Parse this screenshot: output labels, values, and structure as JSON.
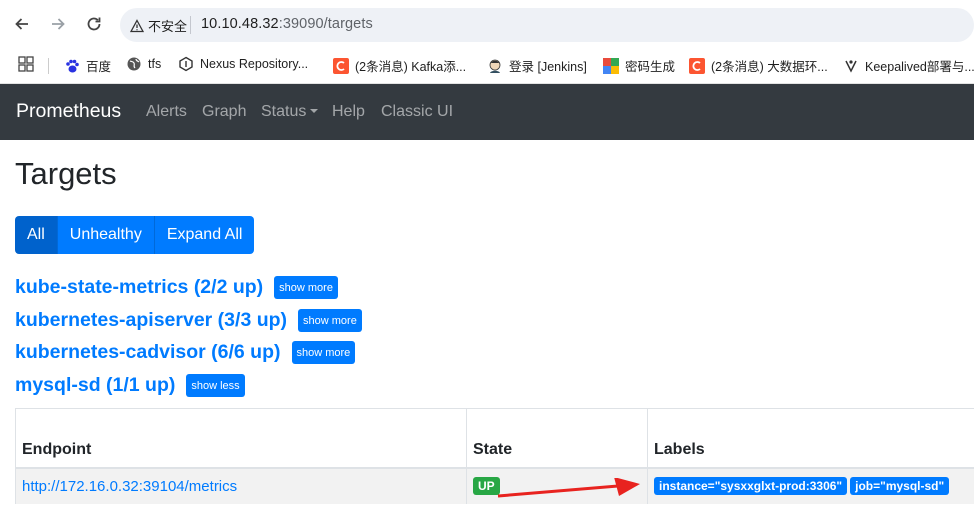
{
  "browser": {
    "security_label": "不安全",
    "url_host": "10.10.48.32",
    "url_path": ":39090/targets",
    "bookmarks": [
      {
        "label": "百度",
        "icon": "paw-icon"
      },
      {
        "label": "tfs",
        "icon": "globe-icon"
      },
      {
        "label": "Nexus Repository...",
        "icon": "nexus-icon"
      },
      {
        "label": "(2条消息) Kafka添...",
        "icon": "csdn-icon"
      },
      {
        "label": "登录 [Jenkins]",
        "icon": "jenkins-icon"
      },
      {
        "label": "密码生成",
        "icon": "puzzle-icon"
      },
      {
        "label": "(2条消息) 大数据环...",
        "icon": "csdn-icon"
      },
      {
        "label": "Keepalived部署与...",
        "icon": "keepalived-icon"
      }
    ]
  },
  "navbar": {
    "brand": "Prometheus",
    "links": [
      "Alerts",
      "Graph",
      "Status",
      "Help",
      "Classic UI"
    ]
  },
  "page": {
    "title": "Targets",
    "filters": [
      "All",
      "Unhealthy",
      "Expand All"
    ],
    "active_filter": "All"
  },
  "pools": [
    {
      "name": "kube-state-metrics (2/2 up)",
      "toggle": "show more"
    },
    {
      "name": "kubernetes-apiserver (3/3 up)",
      "toggle": "show more"
    },
    {
      "name": "kubernetes-cadvisor (6/6 up)",
      "toggle": "show more"
    },
    {
      "name": "mysql-sd (1/1 up)",
      "toggle": "show less"
    }
  ],
  "table": {
    "headers": [
      "Endpoint",
      "State",
      "Labels"
    ],
    "rows": [
      {
        "endpoint": "http://172.16.0.32:39104/metrics",
        "state": "UP",
        "labels": [
          "instance=\"sysxxglxt-prod:3306\"",
          "job=\"mysql-sd\""
        ]
      }
    ]
  },
  "colors": {
    "primary": "#007bff",
    "success": "#28a745",
    "navbar": "#343a40",
    "annotation": "#e8231f"
  }
}
